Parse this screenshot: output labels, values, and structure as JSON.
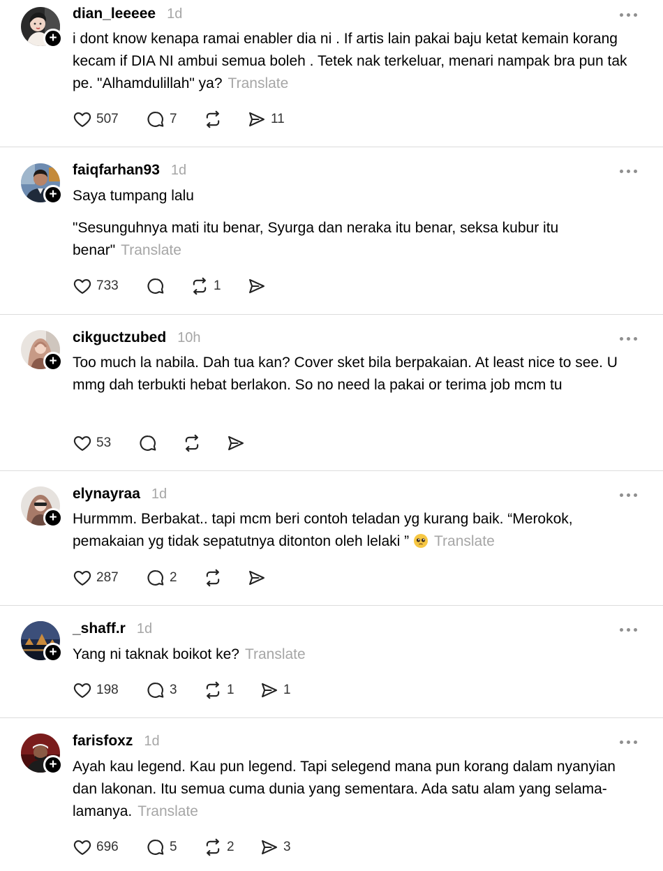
{
  "translate_label": "Translate",
  "posts": [
    {
      "username": "dian_leeeee",
      "time": "1d",
      "text": "i dont know kenapa ramai enabler dia ni . If artis lain pakai baju ketat kemain korang kecam if DIA NI ambui semua boleh . Tetek nak terkeluar, menari nampak bra pun tak pe. \"Alhamdulillah\" ya?",
      "likes": "507",
      "replies": "7",
      "reposts": "",
      "shares": "11"
    },
    {
      "username": "faiqfarhan93",
      "time": "1d",
      "text": "Saya tumpang lalu",
      "text2": "\"Sesunguhnya mati itu benar, Syurga dan neraka itu benar, seksa kubur itu benar\"",
      "likes": "733",
      "replies": "",
      "reposts": "1",
      "shares": ""
    },
    {
      "username": "cikguctzubed",
      "time": "10h",
      "text": "Too much la nabila. Dah tua kan? Cover sket bila berpakaian. At least nice to see. U mmg dah terbukti hebat berlakon. So no need la pakai or terima job mcm tu",
      "likes": "53",
      "replies": "",
      "reposts": "",
      "shares": ""
    },
    {
      "username": "elynayraa",
      "time": "1d",
      "text": "Hurmmm. Berbakat.. tapi mcm beri contoh teladan yg kurang baik. “Merokok, pemakaian yg tidak sepatutnya ditonton oleh lelaki ”",
      "likes": "287",
      "replies": "2",
      "reposts": "",
      "shares": ""
    },
    {
      "username": "_shaff.r",
      "time": "1d",
      "text": "Yang ni taknak boikot ke?",
      "likes": "198",
      "replies": "3",
      "reposts": "1",
      "shares": "1"
    },
    {
      "username": "farisfoxz",
      "time": "1d",
      "text": "Ayah kau legend. Kau pun legend. Tapi selegend mana pun korang dalam nyanyian dan lakonan. Itu semua cuma dunia yang sementara. Ada satu alam yang selama-lamanya.",
      "likes": "696",
      "replies": "5",
      "reposts": "2",
      "shares": "3"
    }
  ],
  "icons": {
    "like": "heart-icon",
    "reply": "comment-icon",
    "repost": "repost-icon",
    "share": "share-icon",
    "more": "more-options-icon",
    "follow": "plus-icon"
  }
}
